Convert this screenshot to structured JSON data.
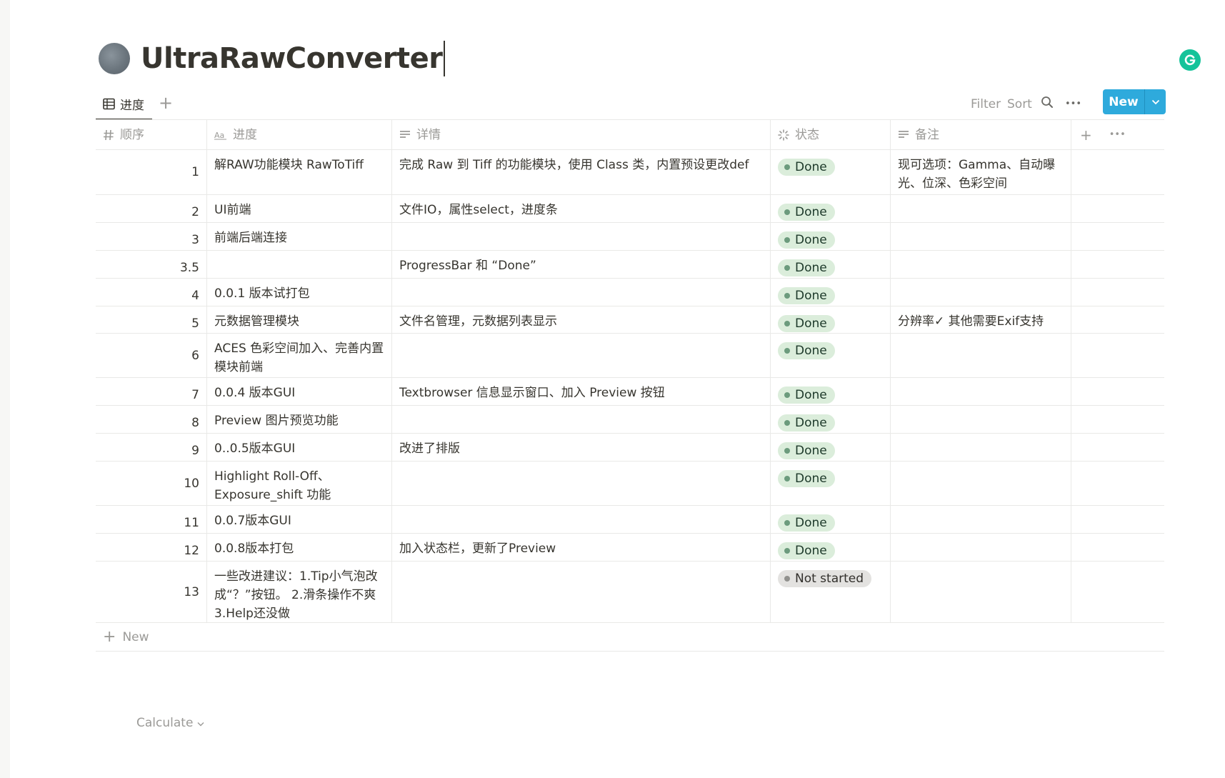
{
  "page": {
    "title": "UltraRawConverter"
  },
  "toolbar": {
    "view_tab": "进度",
    "add_view": "+",
    "filter": "Filter",
    "sort": "Sort",
    "more": "•••",
    "new_label": "New"
  },
  "columns": {
    "order": "顺序",
    "title": "进度",
    "detail": "详情",
    "status": "状态",
    "note": "备注",
    "add": "+",
    "more": "•••"
  },
  "rows": [
    {
      "order": "1",
      "title": "解RAW功能模块 RawToTiff",
      "detail": "完成 Raw 到 Tiff 的功能模块，使用 Class 类，内置预设更改def",
      "status": "Done",
      "note": "现可选项：Gamma、自动曝光、位深、色彩空间"
    },
    {
      "order": "2",
      "title": "UI前端",
      "detail": "文件IO，属性select，进度条",
      "status": "Done",
      "note": ""
    },
    {
      "order": "3",
      "title": "前端后端连接",
      "detail": "",
      "status": "Done",
      "note": ""
    },
    {
      "order": "3.5",
      "title": "",
      "detail": "ProgressBar 和 “Done”",
      "status": "Done",
      "note": ""
    },
    {
      "order": "4",
      "title": "0.0.1 版本试打包",
      "detail": "",
      "status": "Done",
      "note": ""
    },
    {
      "order": "5",
      "title": "元数据管理模块",
      "detail": "文件名管理，元数据列表显示",
      "status": "Done",
      "note": "分辨率✓ 其他需要Exif支持"
    },
    {
      "order": "6",
      "title": "ACES 色彩空间加入、完善内置模块前端",
      "detail": "",
      "status": "Done",
      "note": ""
    },
    {
      "order": "7",
      "title": "0.0.4 版本GUI",
      "detail": "Textbrowser 信息显示窗口、加入 Preview 按钮",
      "status": "Done",
      "note": ""
    },
    {
      "order": "8",
      "title": "Preview 图片预览功能",
      "detail": "",
      "status": "Done",
      "note": ""
    },
    {
      "order": "9",
      "title": "0..0.5版本GUI",
      "detail": "改进了排版",
      "status": "Done",
      "note": ""
    },
    {
      "order": "10",
      "title": "Highlight Roll-Off、Exposure_shift 功能",
      "detail": "",
      "status": "Done",
      "note": ""
    },
    {
      "order": "11",
      "title": "0.0.7版本GUI",
      "detail": "",
      "status": "Done",
      "note": ""
    },
    {
      "order": "12",
      "title": "0.0.8版本打包",
      "detail": "加入状态栏，更新了Preview",
      "status": "Done",
      "note": ""
    },
    {
      "order": "13",
      "title": "一些改进建议：1.Tip小气泡改成“？”按钮。 2.滑条操作不爽 3.Help还没做",
      "detail": "",
      "status": "Not started",
      "note": ""
    }
  ],
  "footer": {
    "new_row": "New",
    "calculate": "Calculate"
  },
  "colors": {
    "accent": "#2eaadc",
    "done_bg": "#dbeddb",
    "not_started_bg": "#e3e2e0",
    "grammarly": "#15c39a"
  }
}
